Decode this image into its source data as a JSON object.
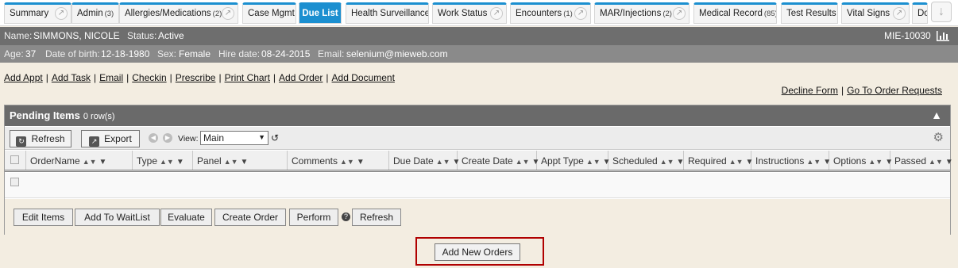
{
  "tabs": [
    {
      "label": "Summary"
    },
    {
      "label": "Admin",
      "count": "(3)"
    },
    {
      "label": "Allergies/Medications",
      "count": "(2)"
    },
    {
      "label": "Case Mgmt"
    },
    {
      "label": "Due List"
    },
    {
      "label": "Health Surveillance"
    },
    {
      "label": "Work Status"
    },
    {
      "label": "Encounters",
      "count": "(1)"
    },
    {
      "label": "MAR/Injections",
      "count": "(2)"
    },
    {
      "label": "Medical Record",
      "count": "(85)"
    },
    {
      "label": "Test Results"
    },
    {
      "label": "Vital Signs"
    },
    {
      "label": "Do"
    }
  ],
  "active_tab": "Due List",
  "patient": {
    "name_label": "Name:",
    "name": "SIMMONS, NICOLE",
    "status_label": "Status:",
    "status": "Active",
    "id": "MIE-10030",
    "age_label": "Age:",
    "age": "37",
    "dob_label": "Date of birth:",
    "dob": "12-18-1980",
    "sex_label": "Sex:",
    "sex": "Female",
    "hire_label": "Hire date:",
    "hire": "08-24-2015",
    "email_label": "Email:",
    "email": "selenium@mieweb.com"
  },
  "actions": [
    "Add Appt",
    "Add Task",
    "Email",
    "Checkin",
    "Prescribe",
    "Print Chart",
    "Add Order",
    "Add Document"
  ],
  "right_links": [
    "Decline Form",
    "Go To Order Requests"
  ],
  "panel": {
    "title": "Pending Items",
    "count": "0 row(s)",
    "refresh": "Refresh",
    "export": "Export",
    "view_label": "View:",
    "view_value": "Main",
    "columns": [
      "OrderName",
      "Type",
      "Panel",
      "Comments",
      "Due Date",
      "Create Date",
      "Appt Type",
      "Scheduled",
      "Required",
      "Instructions",
      "Options",
      "Passed"
    ],
    "buttons": [
      "Edit Items",
      "Add To WaitList",
      "Evaluate",
      "Create Order",
      "Perform",
      "Refresh"
    ]
  },
  "add_new_orders": "Add New Orders",
  "colors": {
    "accent": "#1b8fd0",
    "header_dark": "#6e6e6e",
    "highlight": "#b00000",
    "background": "#f3ede1"
  }
}
